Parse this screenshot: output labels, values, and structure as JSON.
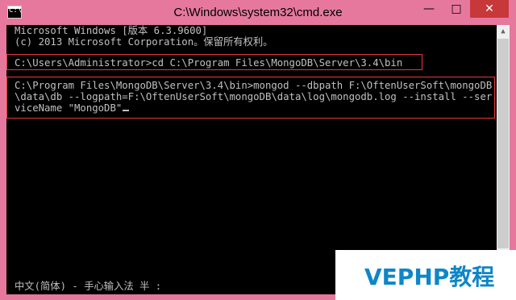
{
  "window": {
    "title": "C:\\Windows\\system32\\cmd.exe",
    "icon_text": "C:\\",
    "minimize": "—",
    "maximize": "□",
    "close": "✕"
  },
  "console": {
    "lines": [
      "Microsoft Windows [版本 6.3.9600]",
      "(c) 2013 Microsoft Corporation。保留所有权利。",
      "",
      "C:\\Users\\Administrator>cd C:\\Program Files\\MongoDB\\Server\\3.4\\bin",
      "",
      "C:\\Program Files\\MongoDB\\Server\\3.4\\bin>mongod --dbpath F:\\OftenUserSoft\\mongoDB",
      "\\data\\db --logpath=F:\\OftenUserSoft\\mongoDB\\data\\log\\mongodb.log --install --ser",
      "viceName \"MongoDB\""
    ],
    "ime_status": "中文(简体) - 手心输入法 半 :"
  },
  "scrollbar": {
    "up": "▲",
    "down": "▼"
  },
  "watermark": {
    "text": "VEPHP教程"
  },
  "colors": {
    "frame": "#e6789e",
    "console_bg": "#000000",
    "console_text": "#c0c0c0",
    "highlight": "#e23b3b",
    "watermark_text": "#0f86c8"
  }
}
